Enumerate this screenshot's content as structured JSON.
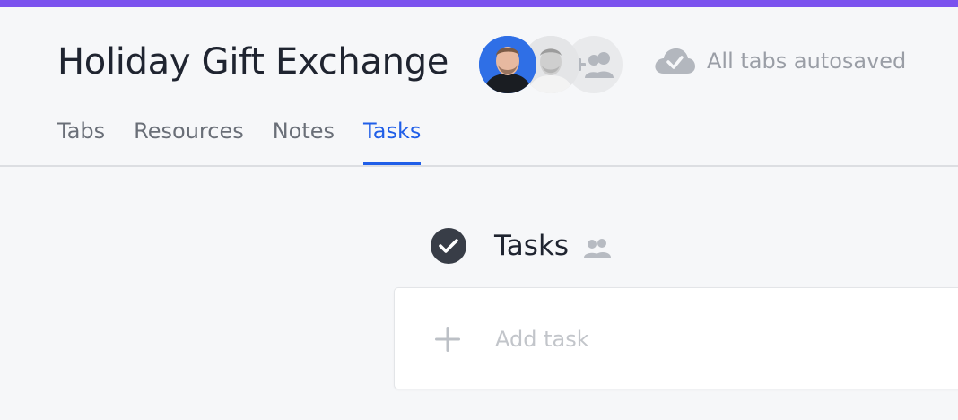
{
  "colors": {
    "accent_bar": "#7b52ee",
    "active_tab": "#1f5ee8",
    "text_primary": "#1f2430",
    "text_muted": "#9a9ea6"
  },
  "header": {
    "title": "Holiday Gift Exchange",
    "collaborators": [
      {
        "name": "avatar-user-1"
      },
      {
        "name": "avatar-user-2"
      }
    ],
    "add_collaborator_icon": "add-people-icon",
    "save_status": {
      "icon": "cloud-check-icon",
      "text": "All tabs autosaved"
    }
  },
  "tabs": [
    {
      "label": "Tabs",
      "active": false
    },
    {
      "label": "Resources",
      "active": false
    },
    {
      "label": "Notes",
      "active": false
    },
    {
      "label": "Tasks",
      "active": true
    }
  ],
  "tasks_section": {
    "icon": "check-circle-icon",
    "title": "Tasks",
    "shared_icon": "people-icon",
    "add_task": {
      "icon": "plus-icon",
      "placeholder": "Add task",
      "value": ""
    }
  }
}
